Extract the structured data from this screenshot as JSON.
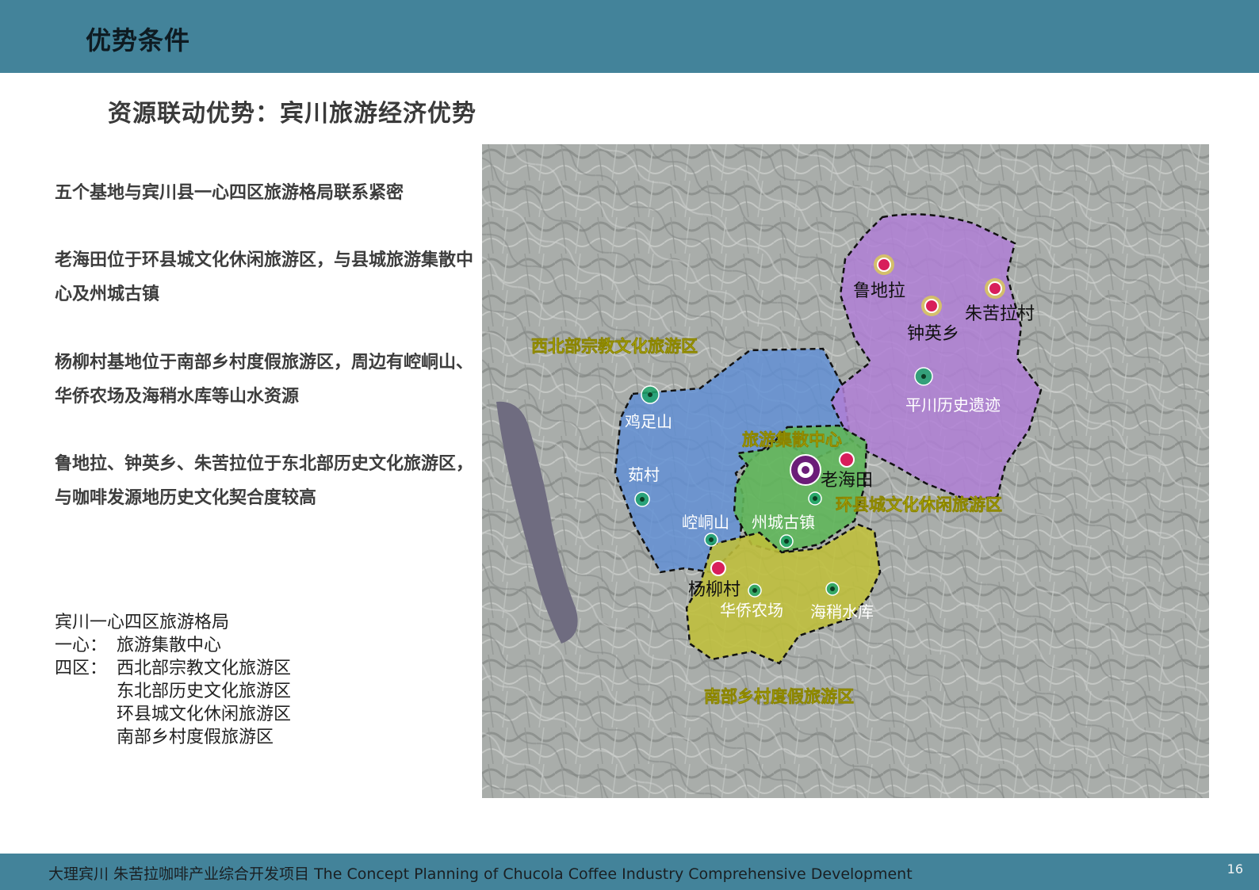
{
  "header": {
    "title": "优势条件"
  },
  "subtitle": "资源联动优势：宾川旅游经济优势",
  "paragraphs": [
    "五个基地与宾川县一心四区旅游格局联系紧密",
    "老海田位于环县城文化休闲旅游区，与县城旅游集散中心及州城古镇",
    "杨柳村基地位于南部乡村度假旅游区，周边有崆峒山、华侨农场及海稍水库等山水资源",
    "鲁地拉、钟英乡、朱苦拉位于东北部历史文化旅游区，与咖啡发源地历史文化契合度较高"
  ],
  "legend": {
    "heading": "宾川一心四区旅游格局",
    "center_label": "一心：",
    "center_value": "旅游集散中心",
    "zones_label": "四区：",
    "zones": [
      "西北部宗教文化旅游区",
      "东北部历史文化旅游区",
      "环县城文化休闲旅游区",
      "南部乡村度假旅游区"
    ]
  },
  "map": {
    "zone_labels": {
      "northwest": "西北部宗教文化旅游区",
      "center": "旅游集散中心",
      "county": "环县城文化休闲旅游区",
      "south": "南部乡村度假旅游区"
    },
    "places": {
      "ludila": "鲁地拉",
      "zhukula": "朱苦拉村",
      "zhongying": "钟英乡",
      "pingchuan": "平川历史遗迹",
      "jizushan": "鸡足山",
      "rucun": "茹村",
      "laohaitian": "老海田",
      "kongtongshan": "崆峒山",
      "zhoucheng": "州城古镇",
      "yangliucun": "杨柳村",
      "huaqiao": "华侨农场",
      "haishao": "海稍水库"
    },
    "colors": {
      "northwest_zone": "#5f8fd6",
      "northeast_zone": "#b07fd6",
      "county_zone": "#5fb65a",
      "south_zone": "#bfbf3a",
      "zone_label": "#f2ee1a",
      "base_marker": "#d81e5b",
      "resource_marker": "#1ea56b"
    }
  },
  "footer": {
    "text": "大理宾川    朱苦拉咖啡产业综合开发项目   The Concept Planning of   Chucola Coffee  Industry Comprehensive Development",
    "page_number": "16"
  }
}
